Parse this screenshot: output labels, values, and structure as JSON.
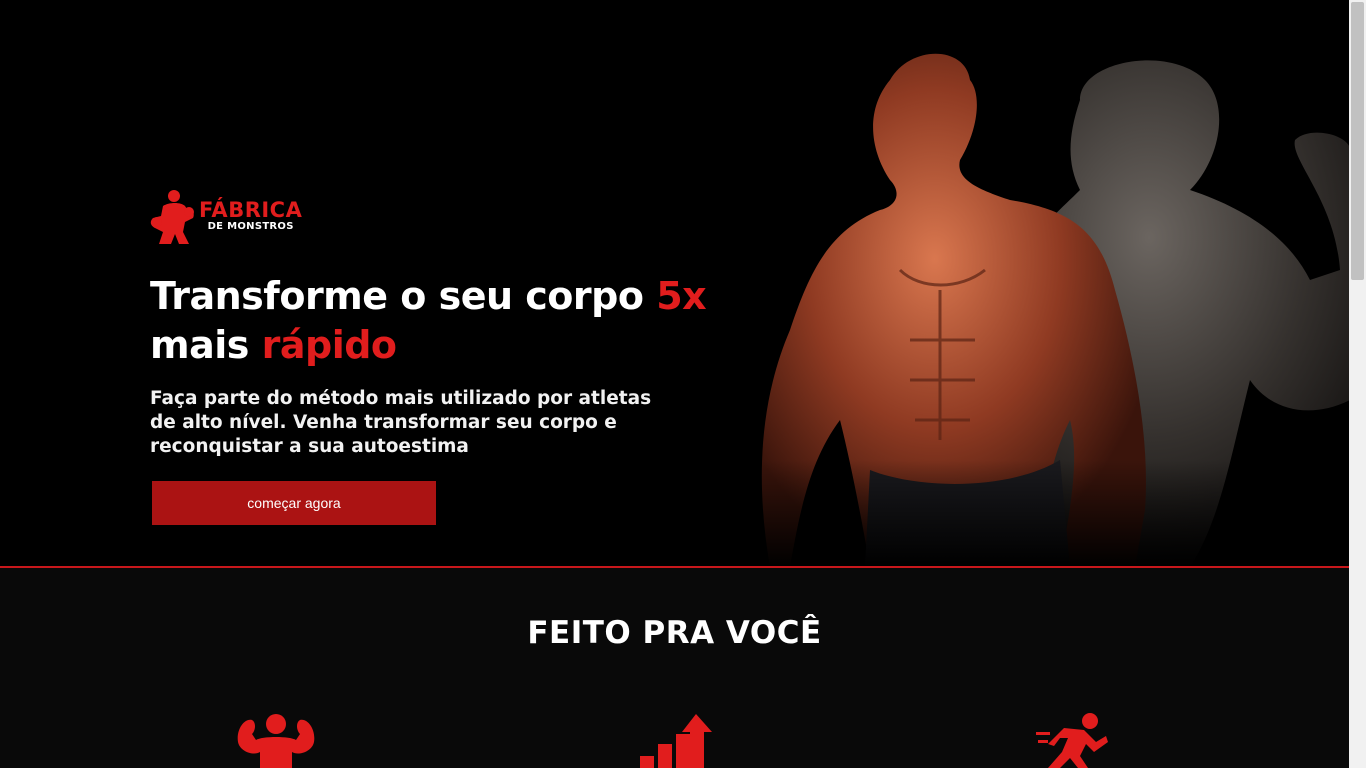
{
  "brand": {
    "name_line1": "FÁBRICA",
    "name_line2": "DE MONSTROS",
    "logo_icon": "boxer-icon"
  },
  "hero": {
    "headline_part1": "Transforme o seu corpo ",
    "headline_accent1": "5x",
    "headline_part2": "mais ",
    "headline_accent2": "rápido",
    "subtext": "Faça parte do método mais utilizado por atletas de alto nível. Venha transformar seu corpo e reconquistar a sua autoestima",
    "cta_label": "começar agora"
  },
  "features": {
    "title": "FEITO PRA VOCÊ",
    "icons": [
      "flexing-body-icon",
      "growth-chart-icon",
      "running-person-icon"
    ]
  },
  "colors": {
    "accent": "#e11d1d",
    "button": "#ab1313",
    "background": "#000000"
  }
}
